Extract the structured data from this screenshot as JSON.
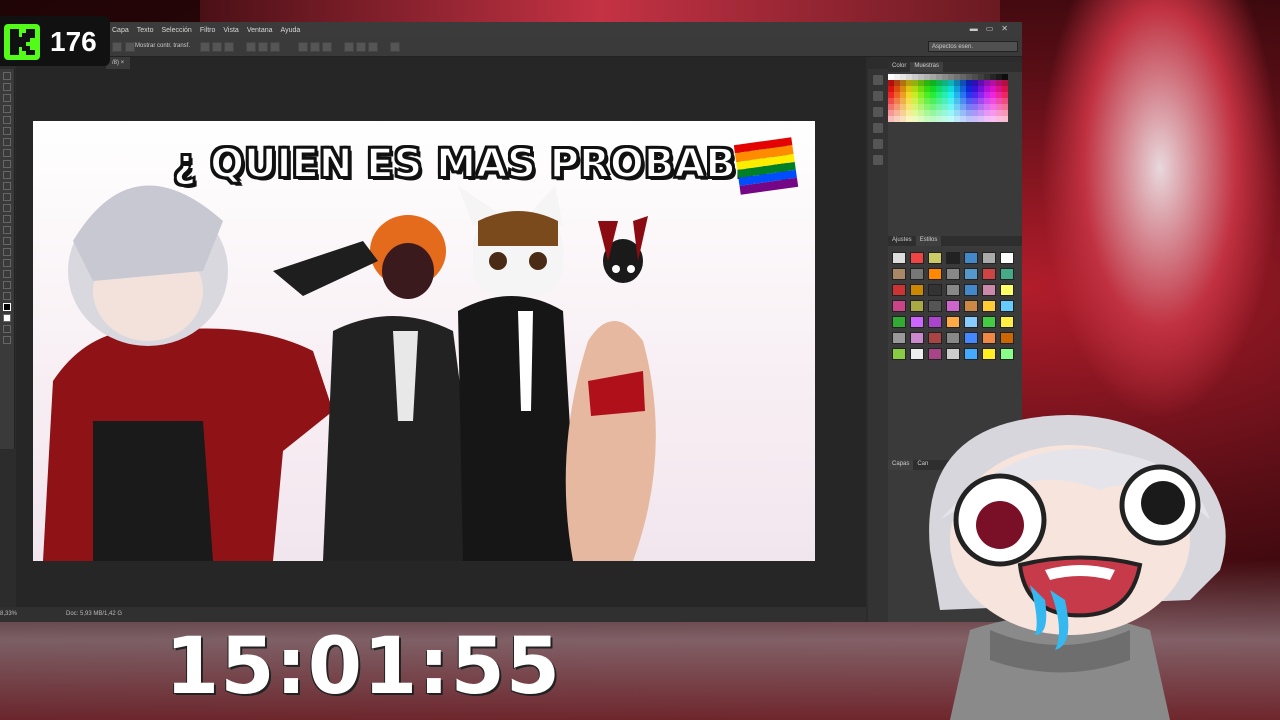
{
  "stream": {
    "viewer_count": "176",
    "timer": "15:01:55",
    "kick_color": "#53fc18"
  },
  "photoshop": {
    "menu": [
      "Capa",
      "Texto",
      "Selección",
      "Filtro",
      "Vista",
      "Ventana",
      "Ayuda"
    ],
    "options": {
      "show_transform": "Mostrar contr. transf."
    },
    "workspace": "Aspectos esen.",
    "doc_tab": "/8) ×",
    "status": {
      "zoom": "8,33%",
      "doc": "Doc: 5,93 MB/1,42 G"
    },
    "panels": {
      "top_tabs": [
        "Color",
        "Muestras"
      ],
      "mid_tabs": [
        "Ajustes",
        "Estilos"
      ],
      "bottom_tabs": [
        "Capas",
        "Can"
      ]
    }
  },
  "canvas": {
    "title": "¿ QUIEN ES MAS PROBABLE",
    "flag_icon": "rainbow-flag-icon"
  }
}
